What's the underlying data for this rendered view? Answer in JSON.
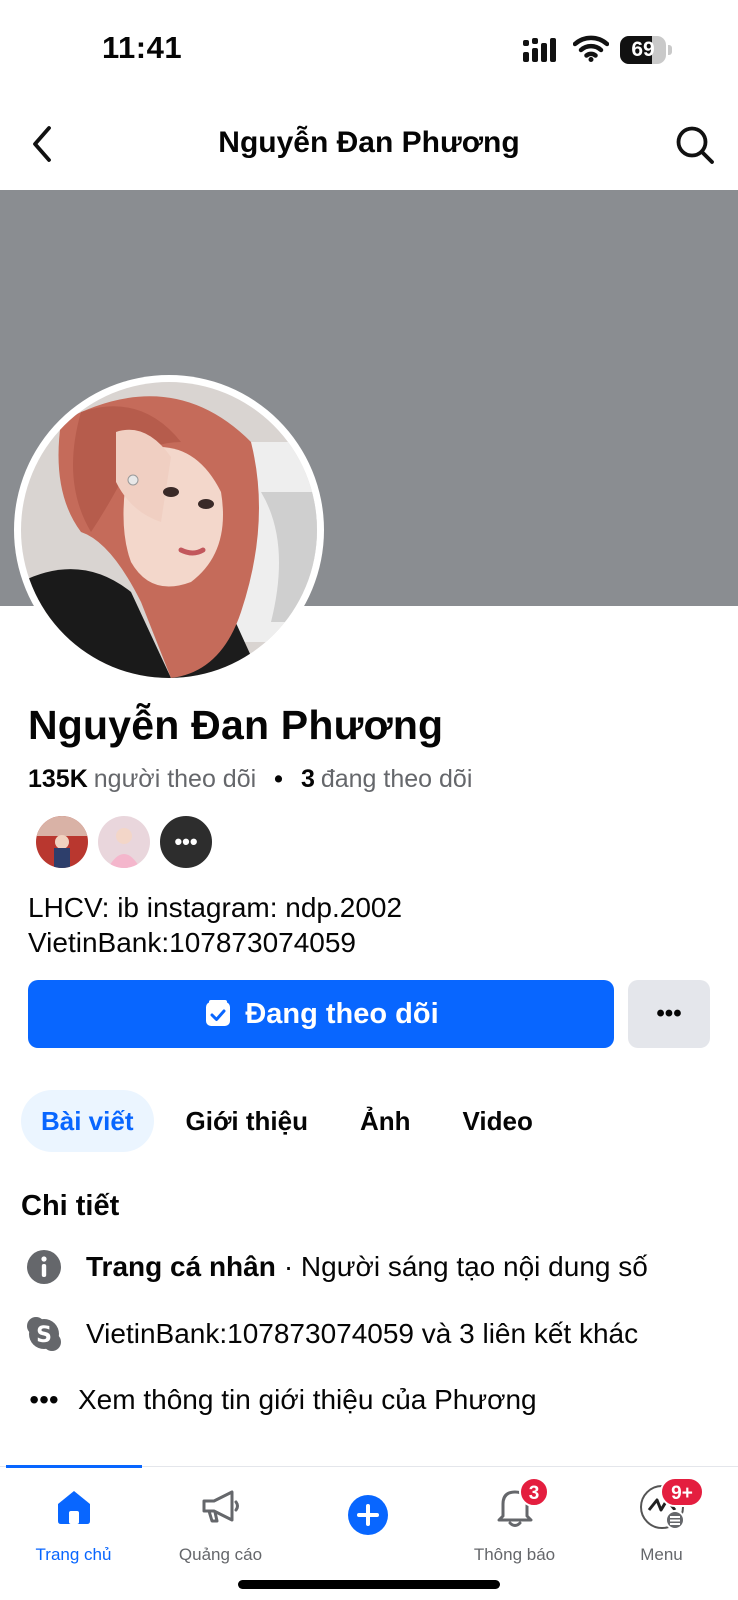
{
  "status_bar": {
    "time": "11:41",
    "battery_percent": 69,
    "battery_label": "69",
    "icons": [
      "signal-icon",
      "wifi-icon",
      "battery-icon"
    ]
  },
  "nav": {
    "title": "Nguyễn Đan Phương",
    "icons": [
      "back-chevron-icon",
      "search-icon"
    ]
  },
  "profile": {
    "name": "Nguyễn Đan Phương",
    "followers_count": "135K",
    "followers_label": "người theo dõi",
    "following_count": "3",
    "following_label": "đang theo dõi",
    "separator": "•",
    "mutuals_more": "•••",
    "bio_line1": "LHCV: ib instagram: ndp.2002",
    "bio_line2": "VietinBank:107873074059"
  },
  "actions": {
    "follow_label": "Đang theo dõi",
    "more_label": "•••"
  },
  "tabs": [
    {
      "label": "Bài viết",
      "active": true
    },
    {
      "label": "Giới thiệu",
      "active": false
    },
    {
      "label": "Ảnh",
      "active": false
    },
    {
      "label": "Video",
      "active": false
    }
  ],
  "details": {
    "title": "Chi tiết",
    "row1_bold": "Trang cá nhân",
    "row1_text": "· Người sáng tạo nội dung số",
    "row2_text": "VietinBank:107873074059 và 3 liên kết khác",
    "row3_icon": "•••",
    "row3_text": "Xem thông tin giới thiệu của Phương"
  },
  "tabbar": {
    "items": [
      {
        "label": "Trang chủ",
        "icon": "home-icon",
        "active": true
      },
      {
        "label": "Quảng cáo",
        "icon": "megaphone-icon",
        "active": false
      },
      {
        "label": "",
        "icon": "plus-circle-icon",
        "active": false
      },
      {
        "label": "Thông báo",
        "icon": "bell-icon",
        "active": false
      },
      {
        "label": "Menu",
        "icon": "menu-avatar-icon",
        "active": false
      }
    ],
    "notifications_badge": "3",
    "menu_badge": "9+"
  },
  "colors": {
    "accent": "#0866ff",
    "cover": "#8a8d91",
    "badge": "#e41e3f",
    "secondary_button": "#e4e6eb",
    "active_tab_bg": "#ebf5ff"
  }
}
